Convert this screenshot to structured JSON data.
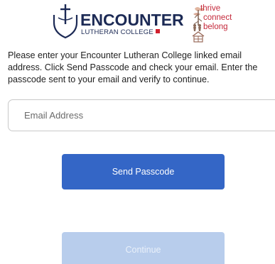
{
  "header": {
    "school_name": "ENCOUNTER",
    "school_subtitle": "LUTHERAN COLLEGE",
    "tagline": [
      "thrive",
      "connect",
      "belong"
    ]
  },
  "instructions": [
    "Please enter your Encounter Lutheran College linked email",
    "address. Click Send Passcode and check your email. Enter the",
    "passcode sent to your email and verify to continue."
  ],
  "email": {
    "placeholder": "Email Address",
    "value": ""
  },
  "buttons": {
    "send_label": "Send Passcode",
    "continue_label": "Continue"
  },
  "colors": {
    "primary": "#3466c6",
    "disabled": "#b8cdec",
    "brand_navy": "#1c2a55",
    "brand_red": "#c4283a"
  },
  "icons": {
    "school_crest": "shield-cross-icon",
    "tagline_art": "house-tree-icon"
  }
}
